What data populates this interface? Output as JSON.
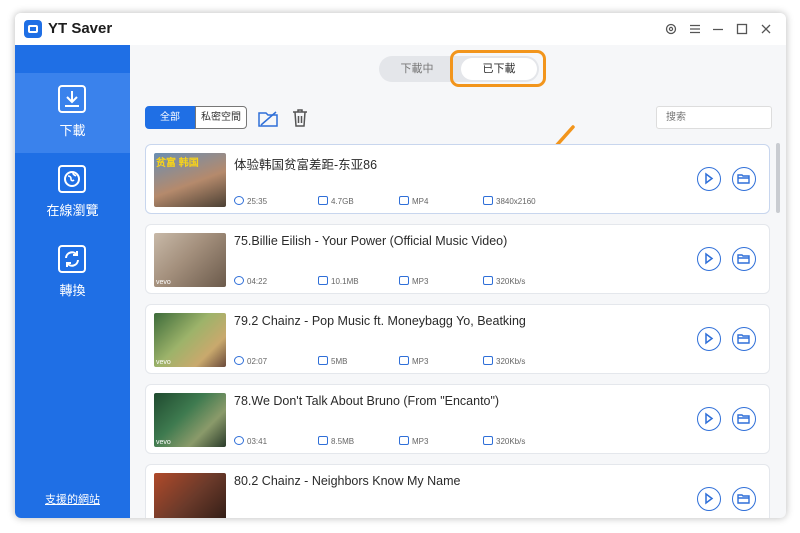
{
  "app": {
    "title": "YT Saver"
  },
  "window_controls": [
    "settings-icon",
    "menu-icon",
    "minimize-icon",
    "maximize-icon",
    "close-icon"
  ],
  "sidebar": {
    "items": [
      {
        "label": "下載",
        "icon": "download-icon",
        "active": true
      },
      {
        "label": "在線瀏覽",
        "icon": "globe-icon",
        "active": false
      },
      {
        "label": "轉換",
        "icon": "convert-icon",
        "active": false
      }
    ],
    "footer_link": "支援的網站"
  },
  "toggle": {
    "downloading": "下載中",
    "downloaded": "已下載",
    "selected": "downloaded"
  },
  "filters": {
    "all": "全部",
    "private": "私密空間"
  },
  "search": {
    "placeholder": "搜索"
  },
  "accent": "#1f6fe5",
  "annotation_color": "#f2951c",
  "items": [
    {
      "title": "体验韩国贫富差距-东亚86",
      "duration": "25:35",
      "size": "4.7GB",
      "format": "MP4",
      "quality": "3840x2160",
      "thumb_text": "贫富  韩国"
    },
    {
      "title": "75.Billie Eilish - Your Power (Official Music Video)",
      "duration": "04:22",
      "size": "10.1MB",
      "format": "MP3",
      "quality": "320Kb/s",
      "thumb_text": "vevo"
    },
    {
      "title": "79.2 Chainz - Pop Music ft. Moneybagg Yo, Beatking",
      "duration": "02:07",
      "size": "5MB",
      "format": "MP3",
      "quality": "320Kb/s",
      "thumb_text": "vevo"
    },
    {
      "title": "78.We Don't Talk About Bruno (From \"Encanto\")",
      "duration": "03:41",
      "size": "8.5MB",
      "format": "MP3",
      "quality": "320Kb/s",
      "thumb_text": "vevo"
    },
    {
      "title": "80.2 Chainz - Neighbors Know My Name",
      "duration": "",
      "size": "",
      "format": "",
      "quality": "",
      "thumb_text": ""
    }
  ]
}
